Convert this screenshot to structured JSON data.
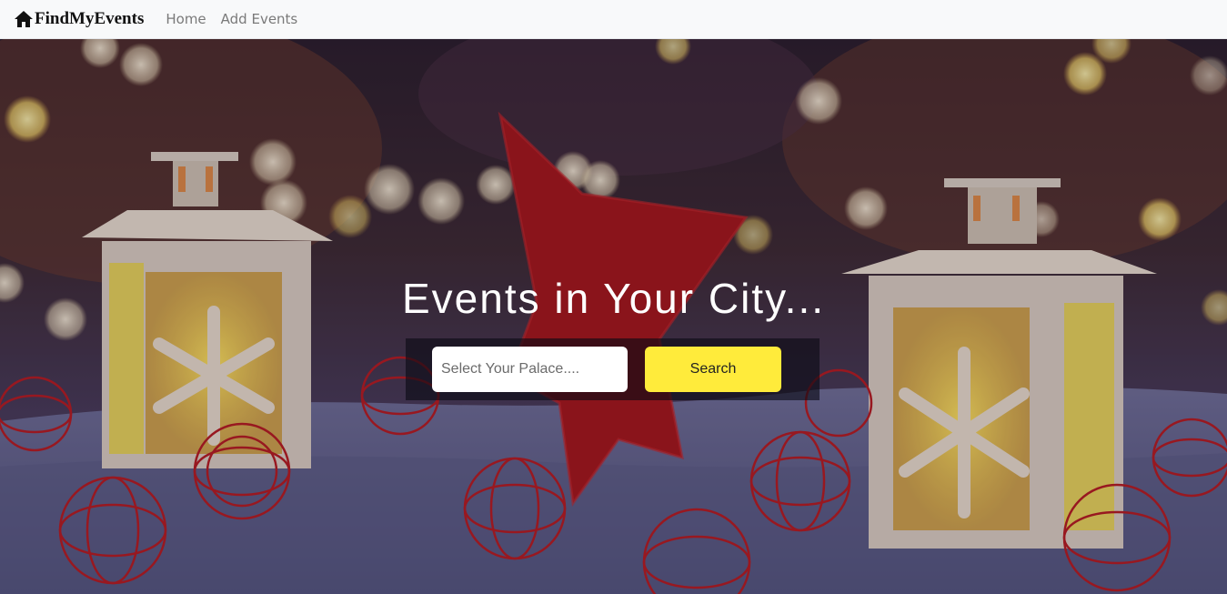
{
  "navbar": {
    "brand": "FindMyEvents",
    "brand_icon": "home-icon",
    "links": [
      {
        "label": "Home"
      },
      {
        "label": "Add Events"
      }
    ]
  },
  "hero": {
    "title": "Events in Your City...",
    "search": {
      "placeholder": "Select Your Palace....",
      "value": "",
      "button_label": "Search"
    },
    "background": "christmas-lanterns-bokeh-photo"
  },
  "colors": {
    "navbar_bg": "#f8f9fa",
    "search_button": "#ffeb3b",
    "title_text": "#ffffff"
  }
}
